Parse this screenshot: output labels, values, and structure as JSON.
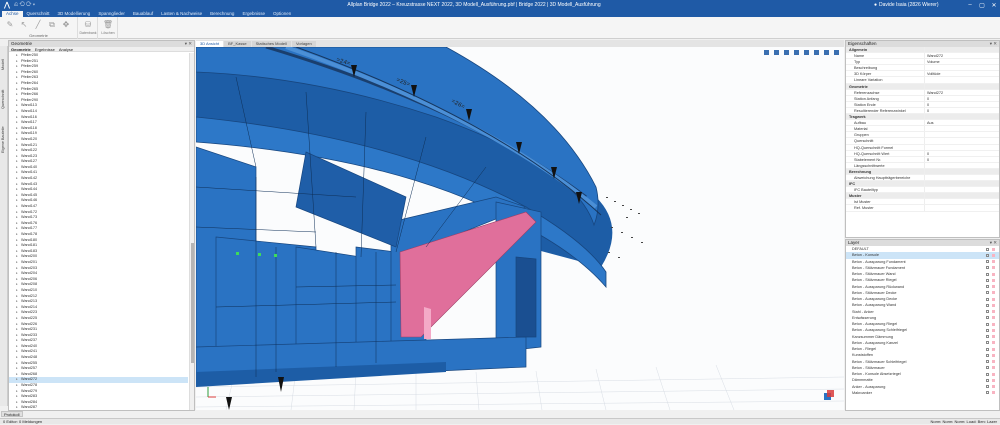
{
  "titlebar": {
    "title": "Allplan Bridge 2022 – Kreuzstrasse NEXT 2022, 3D Modell_Ausführung.pbf | Bridge 2022 | 3D Modell_Ausführung",
    "user": "Davide Isaia (2826 Wierer)",
    "quick_access": "⎌ ⟲ ⟳ ▾"
  },
  "menu": [
    "Achse",
    "Querschnitt",
    "3D Modellierung",
    "Spannglieder",
    "Bauablauf",
    "Lasten & Nachweise",
    "Berechnung",
    "Ergebnisse",
    "Optionen"
  ],
  "ribbon": {
    "groups": [
      {
        "label": "Geometrie"
      },
      {
        "label": "Datenbank"
      },
      {
        "label": "Löschen"
      }
    ],
    "buttons": [
      "Zeichnen",
      "Datenbank",
      "Löschen"
    ]
  },
  "left_panel": {
    "title": "Geometrie",
    "subtabs": [
      "Geometrie",
      "Ergebnisse",
      "Analyse"
    ],
    "vertical_tabs": [
      "Modell",
      "Querschnitt",
      "Eigene Bauteile"
    ],
    "items": [
      "Pfeiler250",
      "Pfeiler251",
      "Pfeiler259",
      "Pfeiler260",
      "Pfeiler263",
      "Pfeiler264",
      "Pfeiler265",
      "Pfeiler266",
      "Pfeiler290",
      "Wand113",
      "Wand114",
      "Wand116",
      "Wand117",
      "Wand118",
      "Wand119",
      "Wand120",
      "Wand121",
      "Wand122",
      "Wand123",
      "Wand127",
      "Wand140",
      "Wand141",
      "Wand142",
      "Wand143",
      "Wand144",
      "Wand145",
      "Wand146",
      "Wand147",
      "Wand172",
      "Wand173",
      "Wand176",
      "Wand177",
      "Wand178",
      "Wand180",
      "Wand181",
      "Wand183",
      "Wand200",
      "Wand201",
      "Wand203",
      "Wand204",
      "Wand206",
      "Wand208",
      "Wand210",
      "Wand212",
      "Wand213",
      "Wand214",
      "Wand223",
      "Wand225",
      "Wand226",
      "Wand231",
      "Wand233",
      "Wand237",
      "Wand240",
      "Wand241",
      "Wand248",
      "Wand255",
      "Wand257",
      "Wand268",
      "Wand272",
      "Wand278",
      "Wand279",
      "Wand283",
      "Wand284",
      "Wand287",
      "Wand289",
      "Wand294",
      "Wand295",
      "Wand296",
      "Wand300"
    ],
    "selected_item": "Wand272",
    "protocol_button": "Protokoll"
  },
  "view_tabs": [
    "3D Ansicht",
    "BF_Kasse",
    "Statisches Modell",
    "Vorlagen"
  ],
  "properties": {
    "title": "Eigenschaften",
    "rows": [
      {
        "k": "Allgemein",
        "v": "",
        "group": true
      },
      {
        "k": "Name",
        "v": "Wand272"
      },
      {
        "k": "Typ",
        "v": "Volume"
      },
      {
        "k": "Beschreibung",
        "v": ""
      },
      {
        "k": "3D Körper",
        "v": "Volltüde"
      },
      {
        "k": "Lineare Variation",
        "v": ""
      },
      {
        "k": "Geometrie",
        "v": "",
        "group": true
      },
      {
        "k": "Referenzachse",
        "v": "Wand272"
      },
      {
        "k": "Station Anfang",
        "v": "0"
      },
      {
        "k": "Station Ende",
        "v": "0"
      },
      {
        "k": "Resultierender Referenzwinkel",
        "v": "0"
      },
      {
        "k": "Tragwerk",
        "v": "",
        "group": true
      },
      {
        "k": "Aufbau",
        "v": "Aus"
      },
      {
        "k": "Material",
        "v": ""
      },
      {
        "k": "Gruppen",
        "v": ""
      },
      {
        "k": "Querschnitt",
        "v": ""
      },
      {
        "k": "HQ-Querschnitt Formel",
        "v": ""
      },
      {
        "k": "HQ-Querschnitt Wert",
        "v": "0"
      },
      {
        "k": "Stabelement Nr.",
        "v": "0"
      },
      {
        "k": "Längsschnittwerte",
        "v": ""
      },
      {
        "k": "Berechnung",
        "v": "",
        "group": true
      },
      {
        "k": "Abweichung Hauptträgerbereiche",
        "v": ""
      },
      {
        "k": "IFC",
        "v": "",
        "group": true
      },
      {
        "k": "IFC Bauteiltyp",
        "v": ""
      },
      {
        "k": "Muster",
        "v": "",
        "group": true
      },
      {
        "k": "Ist Muster",
        "v": ""
      },
      {
        "k": "Ref. Muster",
        "v": ""
      }
    ]
  },
  "layers": {
    "title": "Layer",
    "items": [
      "DEFAULT",
      "Beton - Konsole",
      "Beton - Aussparung Fundament",
      "Beton - Stützmauer Fundament",
      "Beton - Stützmauer Wand",
      "Beton - Stützmauer Riegel",
      "Beton - Aussparung Rückwand",
      "Beton - Stützmauer Decke",
      "Beton - Aussparung Decke",
      "Beton - Aussparung Wand",
      "Stahl - Anker",
      "Entwässerung",
      "Beton - Aussparung Riegel",
      "Beton - Aussparung Schleifriegel",
      "Kanzsummer Dämmung",
      "Beton - Aussparung Kanzel",
      "Beton - Riegel",
      "Kunststoffen",
      "Beton - Stützmauer Schleifriegel",
      "Beton - Stützmauer",
      "Beton - Konsole Absetzriegel",
      "Dämmmatte",
      "Anker - Aussparung",
      "Makroanker"
    ],
    "selected": "Beton - Konsole"
  },
  "status": {
    "left": "0 Editor: 0 Meldungen",
    "right": "Norm: Norm: Norm: Load: Ben: Lazer"
  },
  "colors": {
    "accent": "#1f5aa6",
    "bridge": "#2a73c3",
    "pink": "#e06f9b"
  }
}
